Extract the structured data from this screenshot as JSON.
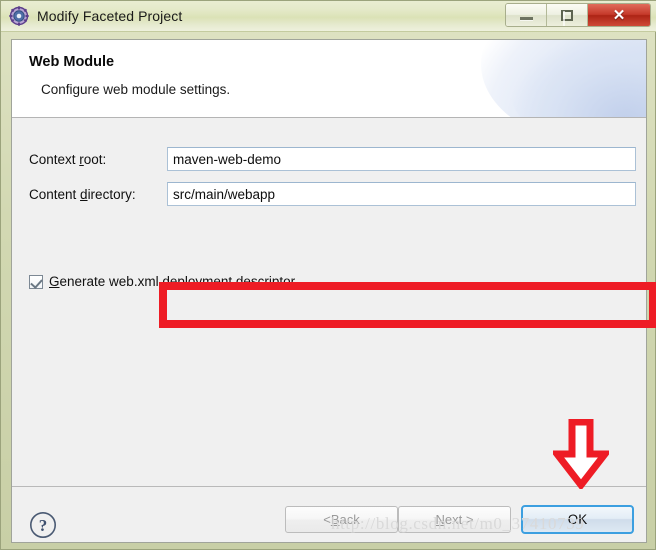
{
  "window": {
    "title": "Modify Faceted Project",
    "icon": "faceted-project-icon",
    "controls": {
      "minimize": "minimize-icon",
      "maximize": "maximize-icon",
      "close": "✕"
    }
  },
  "header": {
    "title": "Web Module",
    "subtitle": "Configure web module settings."
  },
  "form": {
    "context_root": {
      "label_pre": "Context ",
      "label_mnemonic": "r",
      "label_post": "oot:",
      "value": "maven-web-demo"
    },
    "content_directory": {
      "label_pre": "Content ",
      "label_mnemonic": "d",
      "label_post": "irectory:",
      "value": "src/main/webapp"
    },
    "generate_webxml": {
      "checked": true,
      "label_pre": "",
      "label_mnemonic": "G",
      "label_post": "enerate web.xml deployment descriptor"
    }
  },
  "footer": {
    "help": "?",
    "back": {
      "pre": "< ",
      "mnemonic": "B",
      "post": "ack"
    },
    "next": {
      "pre": "",
      "mnemonic": "N",
      "post": "ext >"
    },
    "ok": "OK"
  },
  "watermark": "http://blog.csdn.net/m0_37410739",
  "annotations": {
    "highlight_color": "#ee1c25",
    "highlight_target": "content-directory-row",
    "arrow_color": "#ee1c25",
    "arrow_target": "ok-button",
    "arrow_direction": "down"
  },
  "colors": {
    "titlebar": "#e4e9c8",
    "frame": "#c8cfa6",
    "body": "#f0f0f0",
    "focus_border": "#3c9fe0",
    "close_button": "#c5392a"
  }
}
